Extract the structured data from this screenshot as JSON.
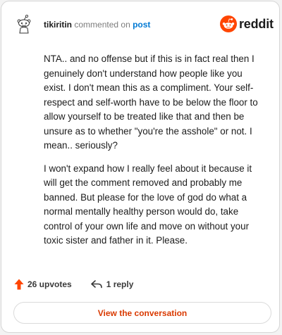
{
  "comment": {
    "username": "tikiritin",
    "action_text": "commented on",
    "post_link": "post",
    "paragraphs": [
      "NTA.. and no offense but if this is in fact real then I genuinely don't understand how people like you exist. I don't mean this as a compliment. Your self-respect and self-worth have to be below the floor to allow yourself to be treated like that and then be unsure as to whether \"you're the asshole\" or not. I mean.. seriously?",
      "I won't expand how I really feel about it because it will get the comment removed and probably me banned. But please for the love of god do what a normal mentally healthy person would do, take control of your own life and move on without your toxic sister and father in it. Please."
    ],
    "upvotes_label": "26 upvotes",
    "replies_label": "1 reply"
  },
  "brand": {
    "wordmark": "reddit",
    "icon": "reddit-snoo-icon",
    "color": "#ff4500"
  },
  "cta": {
    "label": "View the conversation"
  },
  "icons": {
    "avatar": "snoo-avatar-icon",
    "upvote": "upvote-arrow-icon",
    "reply": "reply-arrow-icon"
  },
  "colors": {
    "upvote": "#ff4500",
    "link": "#0079d3",
    "cta_text": "#d93900"
  }
}
